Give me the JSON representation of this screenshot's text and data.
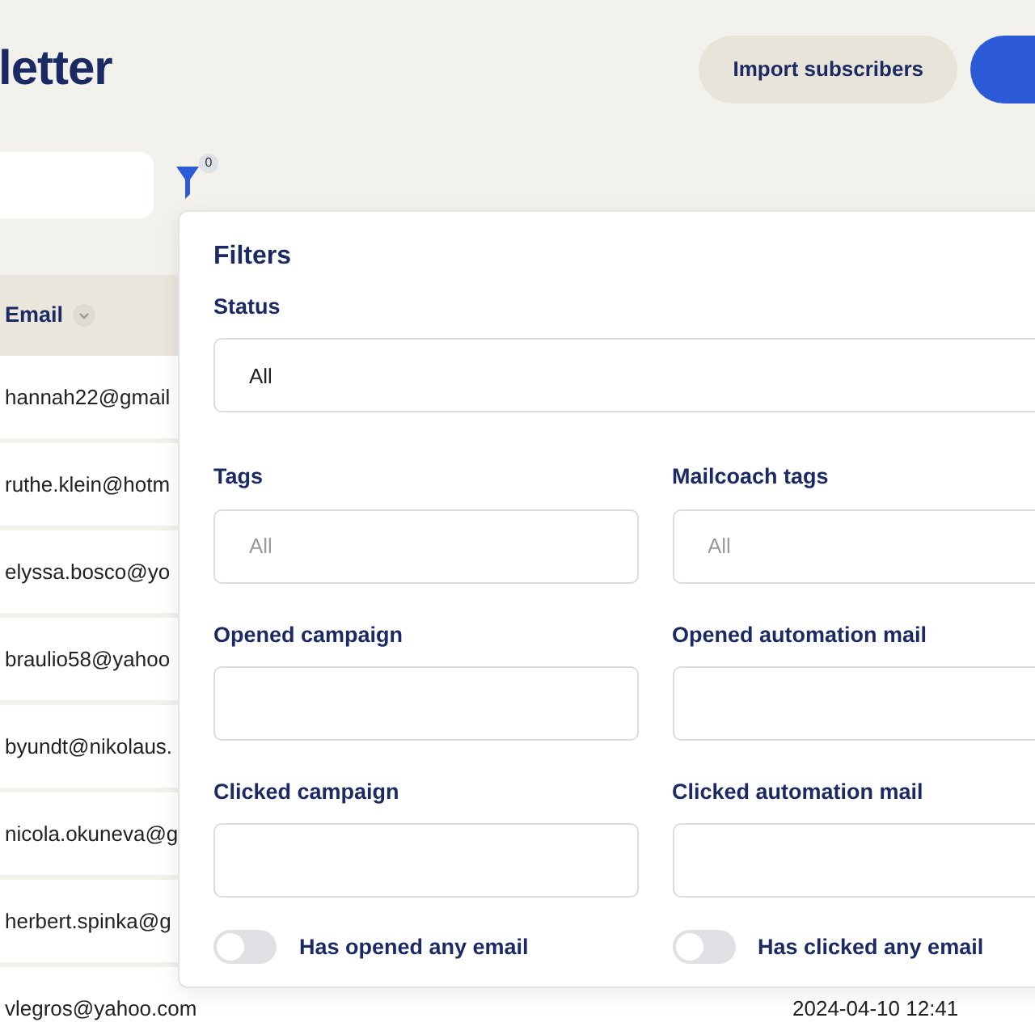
{
  "header": {
    "title": "letter",
    "import_button": "Import subscribers"
  },
  "filter": {
    "count": "0"
  },
  "table": {
    "columns": [
      {
        "label": "Email"
      }
    ],
    "rows": [
      {
        "email": "hannah22@gmail"
      },
      {
        "email": "ruthe.klein@hotm"
      },
      {
        "email": "elyssa.bosco@yo"
      },
      {
        "email": "braulio58@yahoo"
      },
      {
        "email": "byundt@nikolaus."
      },
      {
        "email": "nicola.okuneva@g"
      },
      {
        "email": "herbert.spinka@g"
      },
      {
        "email": "vlegros@yahoo.com",
        "date": "2024-04-10 12:41"
      }
    ]
  },
  "filters_panel": {
    "title": "Filters",
    "status": {
      "label": "Status",
      "value": "All"
    },
    "fields": [
      {
        "label": "Tags",
        "placeholder": "All"
      },
      {
        "label": "Mailcoach tags",
        "placeholder": "All"
      },
      {
        "label": "Opened campaign"
      },
      {
        "label": "Opened automation mail"
      },
      {
        "label": "Clicked campaign"
      },
      {
        "label": "Clicked automation mail"
      }
    ],
    "toggles": [
      {
        "label": "Has opened any email",
        "on": false
      },
      {
        "label": "Has clicked any email",
        "on": false
      }
    ]
  }
}
